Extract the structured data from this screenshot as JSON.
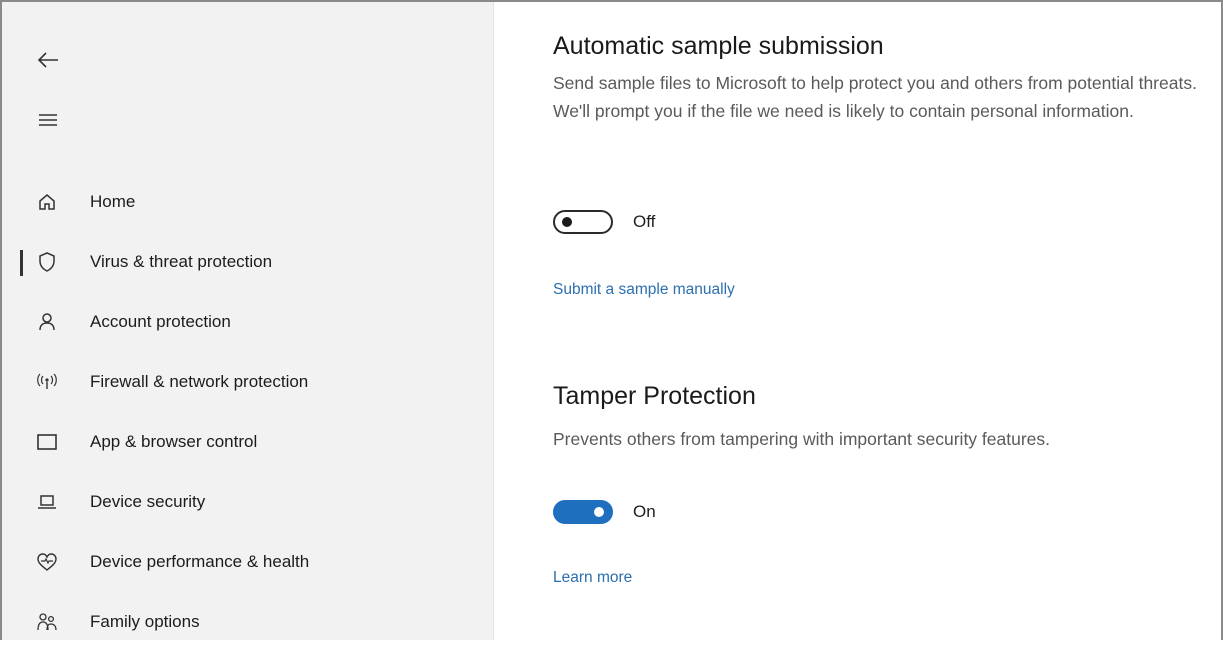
{
  "sidebar": {
    "items": [
      {
        "label": "Home",
        "icon": "home-icon"
      },
      {
        "label": "Virus & threat protection",
        "icon": "shield-icon",
        "active": true
      },
      {
        "label": "Account protection",
        "icon": "person-icon"
      },
      {
        "label": "Firewall & network protection",
        "icon": "wifi-antenna-icon"
      },
      {
        "label": "App & browser control",
        "icon": "app-window-icon"
      },
      {
        "label": "Device security",
        "icon": "laptop-icon"
      },
      {
        "label": "Device performance & health",
        "icon": "heart-pulse-icon"
      },
      {
        "label": "Family options",
        "icon": "family-icon"
      }
    ]
  },
  "sample_submission": {
    "title": "Automatic sample submission",
    "description": "Send sample files to Microsoft to help protect you and others from potential threats. We'll prompt you if the file we need is likely to contain personal information.",
    "toggle_state": "Off",
    "link": "Submit a sample manually"
  },
  "tamper_protection": {
    "title": "Tamper Protection",
    "description": "Prevents others from tampering with important security features.",
    "toggle_state": "On",
    "link": "Learn more"
  },
  "colors": {
    "accent": "#1f6fbf",
    "link": "#2c6fb0",
    "sidebar_bg": "#f2f2f2"
  }
}
